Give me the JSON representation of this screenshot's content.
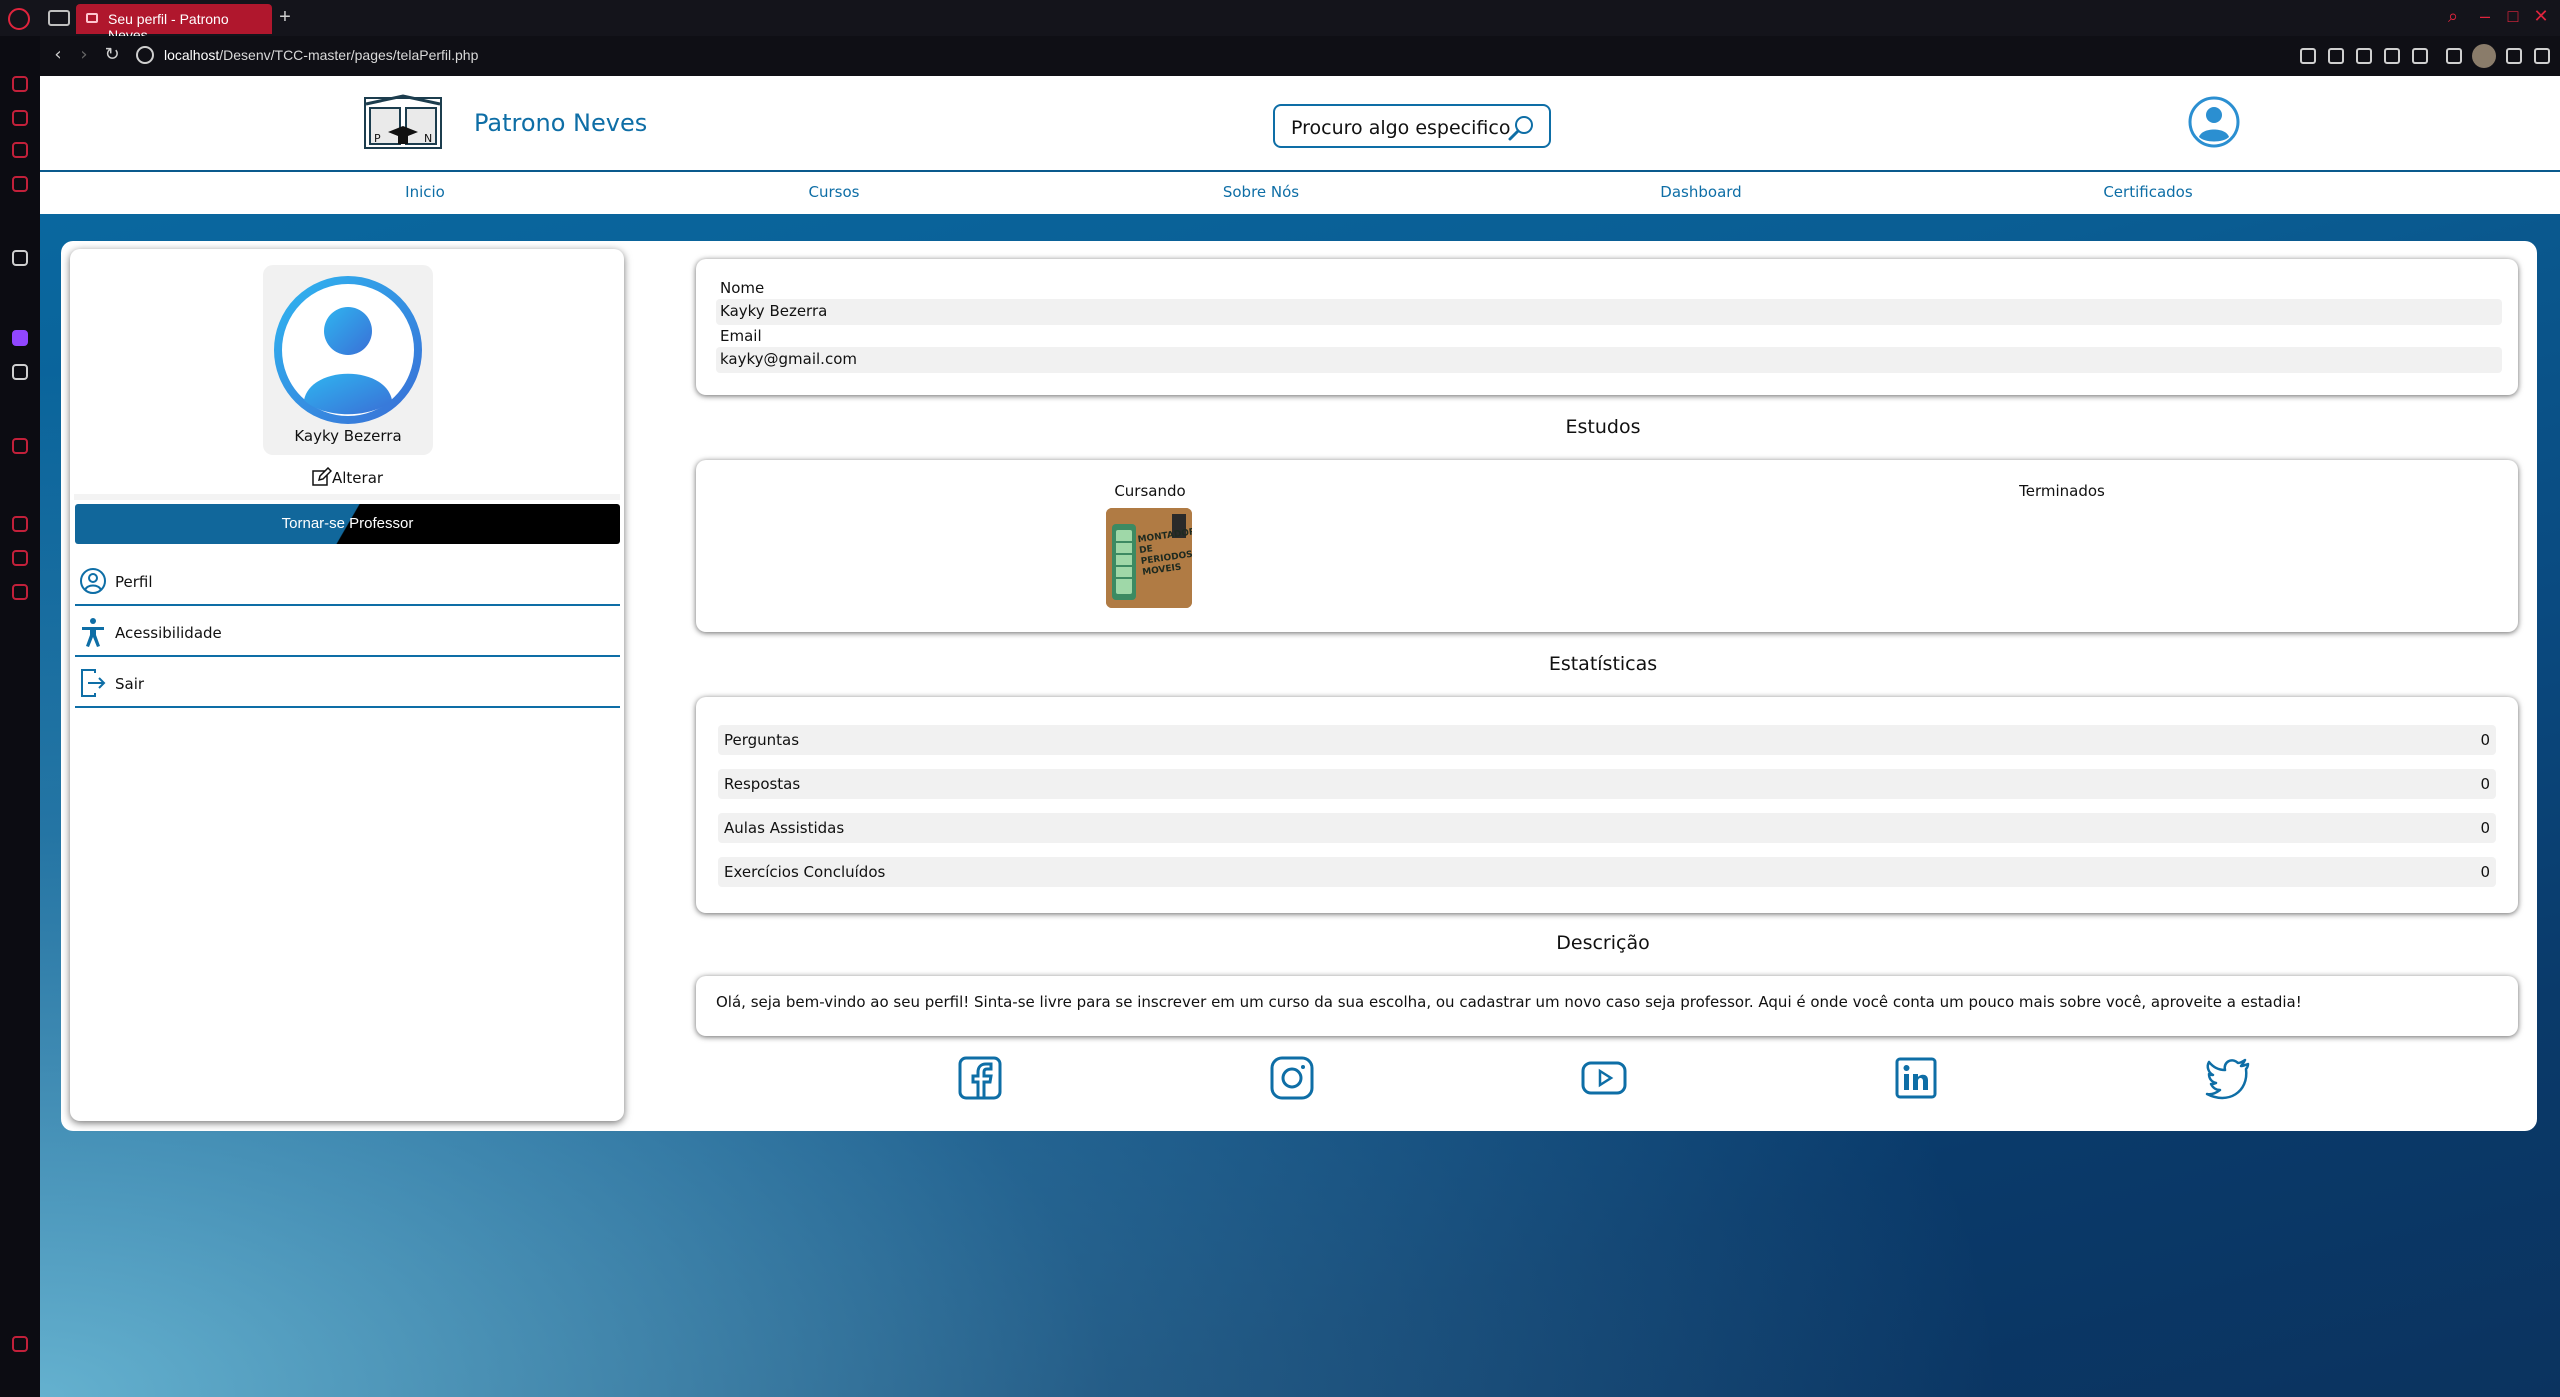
{
  "browser": {
    "tab_title": "Seu perfil - Patrono Neves",
    "new_tab": "+",
    "url_host": "localhost",
    "url_path": "/Desenv/TCC-master/pages/telaPerfil.php"
  },
  "header": {
    "brand": "Patrono Neves",
    "search_placeholder": "Procuro algo especifico"
  },
  "nav": {
    "items": [
      "Inicio",
      "Cursos",
      "Sobre Nós",
      "Dashboard",
      "Certificados"
    ]
  },
  "profile": {
    "name": "Kayky Bezerra",
    "edit_label": "Alterar",
    "become_teacher": "Tornar-se Professor",
    "menu": [
      {
        "label": "Perfil",
        "icon": "user-circle-icon"
      },
      {
        "label": "Acessibilidade",
        "icon": "accessibility-icon"
      },
      {
        "label": "Sair",
        "icon": "logout-icon"
      }
    ]
  },
  "info": {
    "name_label": "Nome",
    "name_value": "Kayky Bezerra",
    "email_label": "Email",
    "email_value": "kayky@gmail.com"
  },
  "studies": {
    "title": "Estudos",
    "in_progress": "Cursando",
    "finished": "Terminados",
    "course_thumb_text": "MONTADOR DE PERIODOS MOVEIS"
  },
  "stats": {
    "title": "Estatísticas",
    "rows": [
      {
        "label": "Perguntas",
        "value": "0"
      },
      {
        "label": "Respostas",
        "value": "0"
      },
      {
        "label": "Aulas Assistidas",
        "value": "0"
      },
      {
        "label": "Exercícios Concluídos",
        "value": "0"
      }
    ]
  },
  "description": {
    "title": "Descrição",
    "text": "Olá, seja bem-vindo ao seu perfil! Sinta-se livre para se inscrever em um curso da sua escolha, ou cadastrar um novo caso seja professor. Aqui é onde você conta um pouco mais sobre você, aproveite a estadia!"
  },
  "social": [
    "facebook-icon",
    "instagram-icon",
    "youtube-icon",
    "linkedin-icon",
    "twitter-icon"
  ],
  "colors": {
    "brand_blue": "#0e6ea6",
    "tab_red": "#b0172d",
    "page_gradient_dark": "#0a3a6a",
    "page_gradient_light": "#74c4de"
  }
}
